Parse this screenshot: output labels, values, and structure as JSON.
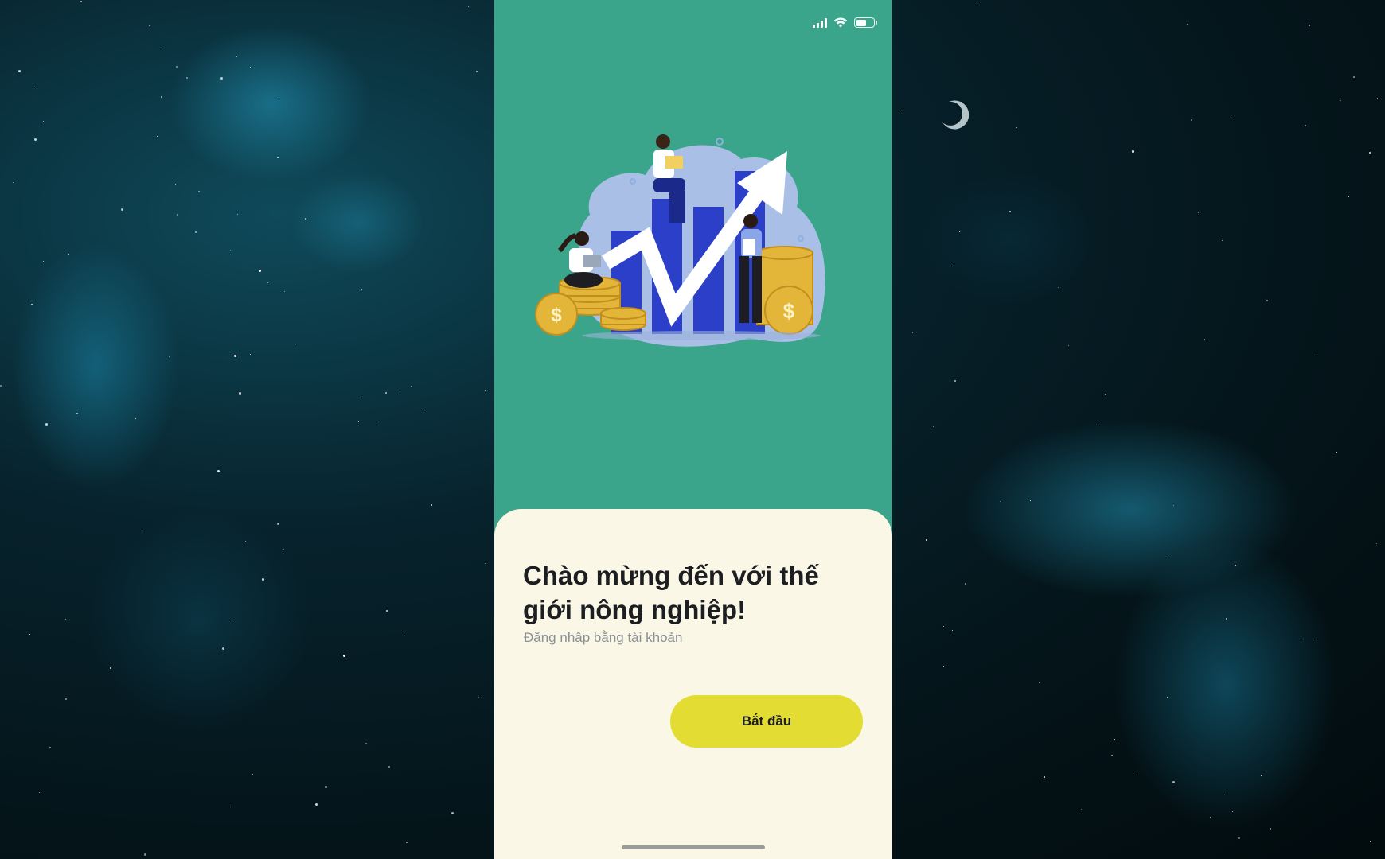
{
  "colors": {
    "phone_background": "#3aa58a",
    "card_background": "#fbf7e7",
    "button_background": "#e2dc33",
    "title_text": "#1c1e22",
    "subtitle_text": "#8a8f95"
  },
  "status_bar": {
    "icons": [
      "cellular-signal-icon",
      "wifi-icon",
      "battery-icon"
    ],
    "battery_level": 0.6
  },
  "illustration": {
    "icon": "growth-chart-illustration"
  },
  "welcome": {
    "title": "Chào mừng đến với thế giới nông nghiệp!",
    "subtitle": "Đăng nhập bằng tài khoản",
    "start_label": "Bắt đầu"
  }
}
